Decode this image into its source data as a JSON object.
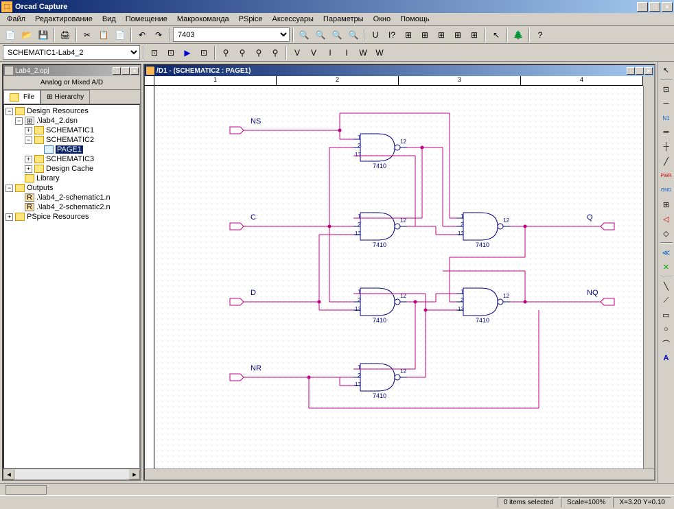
{
  "title": "Orcad Capture",
  "menu": [
    "Файл",
    "Редактирование",
    "Вид",
    "Помещение",
    "Макрокоманда",
    "PSpice",
    "Аксессуары",
    "Параметры",
    "Окно",
    "Помощь"
  ],
  "part_selector": "7403",
  "schematic_selector": "SCHEMATIC1-Lab4_2",
  "project": {
    "filename": "Lab4_2.opj",
    "subtitle": "Analog or Mixed A/D",
    "tabs": [
      "File",
      "Hierarchy"
    ]
  },
  "tree": {
    "root": "Design Resources",
    "dsn": ".\\lab4_2.dsn",
    "sch1": "SCHEMATIC1",
    "sch2": "SCHEMATIC2",
    "page1": "PAGE1",
    "sch3": "SCHEMATIC3",
    "cache": "Design Cache",
    "library": "Library",
    "outputs": "Outputs",
    "out1": ".\\lab4_2-schematic1.n",
    "out2": ".\\lab4_2-schematic2.n",
    "pspice": "PSpice Resources"
  },
  "schematic": {
    "title": "/D1 - (SCHEMATIC2 : PAGE1)",
    "ruler_marks": [
      "1",
      "2",
      "3",
      "4"
    ],
    "inputs": [
      "NS",
      "C",
      "D",
      "NR"
    ],
    "outputs": [
      "Q",
      "NQ"
    ],
    "gate_label": "7410",
    "pins": [
      "1",
      "2",
      "13",
      "12"
    ]
  },
  "status": {
    "items": "0 items selected",
    "scale": "Scale=100%",
    "coords": "X=3.20 Y=0.10"
  }
}
